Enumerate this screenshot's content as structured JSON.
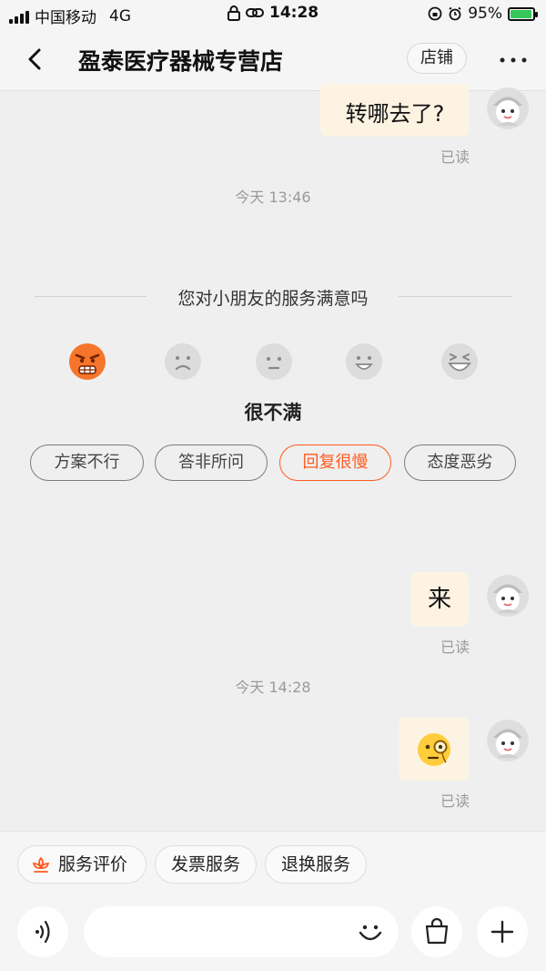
{
  "status_bar": {
    "carrier": "中国移动",
    "network": "4G",
    "time": "14:28",
    "battery": "95%",
    "battery_level": 0.95
  },
  "header": {
    "title": "盈泰医疗器械专营店",
    "shop_button": "店铺"
  },
  "messages": [
    {
      "text": "转哪去了?",
      "read": "已读"
    }
  ],
  "timestamps": [
    "今天 13:46",
    "今天 14:28"
  ],
  "survey": {
    "title": "您对小朋友的服务满意吗",
    "selected_index": 0,
    "rating_label": "很不满",
    "tags": [
      "方案不行",
      "答非所问",
      "回复很慢",
      "态度恶劣"
    ],
    "selected_tag_index": 2
  },
  "messages_after": [
    {
      "text": "来",
      "read": "已读"
    },
    {
      "emoji": "face-with-monocle",
      "read": "已读"
    }
  ],
  "quick_chips": [
    "服务评价",
    "发票服务",
    "退换服务"
  ],
  "colors": {
    "accent": "#ff5a1f",
    "bubble": "#fdf3e2",
    "angry_face": "#f5762a"
  }
}
